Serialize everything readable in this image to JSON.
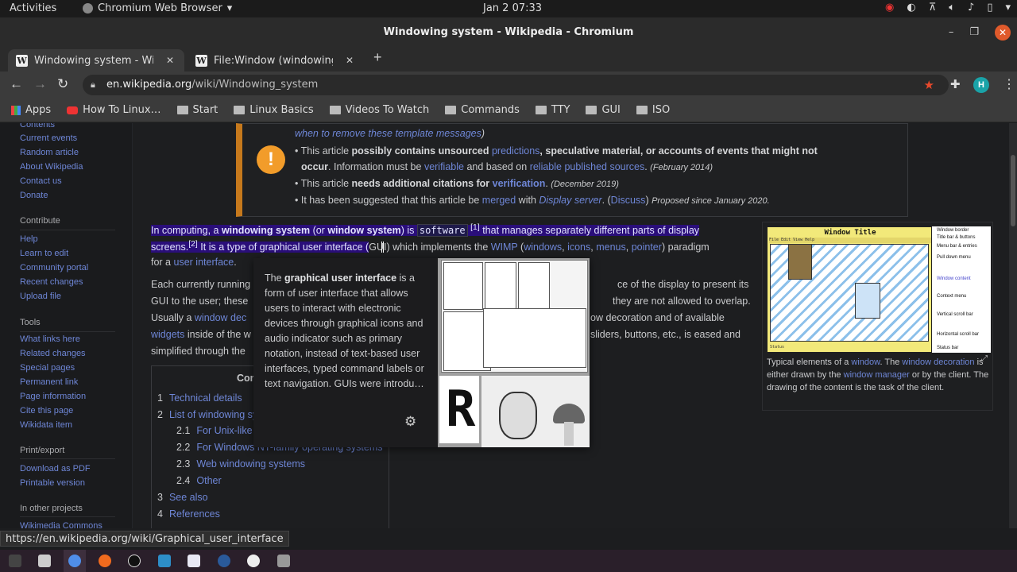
{
  "topbar": {
    "activities": "Activities",
    "app_name": "Chromium Web Browser",
    "clock": "Jan 2  07:33"
  },
  "window": {
    "title": "Windowing system - Wikipedia - Chromium",
    "minimize": "–",
    "maximize": "❐",
    "close": "✕"
  },
  "tabs": [
    {
      "label": "Windowing system - Wiki",
      "favicon": "W",
      "close": "✕"
    },
    {
      "label": "File:Window (windowing",
      "favicon": "W",
      "close": "✕"
    }
  ],
  "new_tab": "+",
  "toolbar": {
    "back": "←",
    "forward": "→",
    "reload": "↻",
    "url_host": "en.wikipedia.org",
    "url_path": "/wiki/Windowing_system",
    "avatar_letter": "H"
  },
  "bookmarks": [
    {
      "label": "Apps",
      "icon": "apps-grid-icon"
    },
    {
      "label": "How To Linux…",
      "icon": "youtube-icon"
    },
    {
      "label": "Start",
      "icon": "folder-icon"
    },
    {
      "label": "Linux Basics",
      "icon": "folder-icon"
    },
    {
      "label": "Videos To Watch",
      "icon": "folder-icon"
    },
    {
      "label": "Commands",
      "icon": "folder-icon"
    },
    {
      "label": "TTY",
      "icon": "folder-icon"
    },
    {
      "label": "GUI",
      "icon": "folder-icon"
    },
    {
      "label": "ISO",
      "icon": "folder-icon"
    }
  ],
  "sidebar": {
    "nav": [
      "Contents",
      "Current events",
      "Random article",
      "About Wikipedia",
      "Contact us",
      "Donate"
    ],
    "contribute_heading": "Contribute",
    "contribute": [
      "Help",
      "Learn to edit",
      "Community portal",
      "Recent changes",
      "Upload file"
    ],
    "tools_heading": "Tools",
    "tools": [
      "What links here",
      "Related changes",
      "Special pages",
      "Permanent link",
      "Page information",
      "Cite this page",
      "Wikidata item"
    ],
    "print_heading": "Print/export",
    "print": [
      "Download as PDF",
      "Printable version"
    ],
    "other_heading": "In other projects",
    "other": [
      "Wikimedia Commons"
    ]
  },
  "ambox": {
    "top_line": "when to remove these template messages",
    "item1_pre": "This article ",
    "item1_bold": "possibly contains unsourced ",
    "item1_link": "predictions",
    "item1_bold2": ", speculative material, or accounts of events that might not",
    "item1_line2_bold": "occur",
    "item1_line2_text": ". Information must be ",
    "item1_link2": "verifiable",
    "item1_text3": " and based on ",
    "item1_link3": "reliable published sources",
    "item1_date": "(February 2014)",
    "item2_pre": "This article ",
    "item2_bold": "needs additional citations for ",
    "item2_link": "verification",
    "item2_date": "(December 2019)",
    "item3_pre": "It has been suggested that this article be ",
    "item3_link": "merged",
    "item3_mid": " with ",
    "item3_link2": "Display server",
    "item3_discuss": "Discuss",
    "item3_date": "Proposed since January 2020."
  },
  "intro": {
    "l1_a": "In computing, a ",
    "l1_b": "windowing system",
    "l1_c": " (or ",
    "l1_d": "window system",
    "l1_e": ") is ",
    "l1_code": "software",
    "l1_ref": "[1]",
    "l1_f": " that manages separately different parts of display",
    "l2_a": "screens.",
    "l2_ref": "[2]",
    "l2_b": " It is a type of graphical user interface (",
    "l2_c": "GUI) which implements the ",
    "l2_wimp": "WIMP",
    "l2_windows": "windows",
    "l2_icons": "icons",
    "l2_menus": "menus",
    "l2_pointer": "pointer",
    "l2_end": ") paradigm",
    "l3_a": "for a ",
    "l3_link": "user interface",
    "p2_l1a": "Each currently running",
    "p2_l1b": "ce of the display to present its",
    "p2_l2a": "GUI to the user; these",
    "p2_l2b": "they are not allowed to overlap.",
    "p2_l3a": "Usually a ",
    "p2_l3link": "window dec",
    "p2_l3b": "ow decoration and of available",
    "p2_l4link": "widgets",
    "p2_l4a": " inside of the w",
    "p2_l4b": "sliders, buttons, etc., is eased and",
    "p2_l5a": "simplified through the"
  },
  "toc": {
    "title": "Contents",
    "items": [
      {
        "num": "1",
        "label": "Technical details"
      },
      {
        "num": "2",
        "label": "List of windowing systems"
      },
      {
        "num": "2.1",
        "label": "For Unix-like"
      },
      {
        "num": "2.2",
        "label": "For Windows NT-family operating systems"
      },
      {
        "num": "2.3",
        "label": "Web windowing systems"
      },
      {
        "num": "2.4",
        "label": "Other"
      },
      {
        "num": "3",
        "label": "See also"
      },
      {
        "num": "4",
        "label": "References"
      }
    ]
  },
  "popup": {
    "pre": "The ",
    "bold": "graphical user interface",
    "text": " is a form of user interface that allows users to interact with electronic devices through graphical icons and audio indicator such as primary notation, instead of text-based user interfaces, typed command labels or text navigation. GUIs were introdu…"
  },
  "figure": {
    "window_title": "Window Title",
    "menu": "File Edit View Help",
    "status": "Status",
    "labels": [
      "Window border",
      "Title bar & buttons",
      "Menu bar & entries",
      "Pull down menu",
      "Window content",
      "Context menu",
      "Vertical scroll bar",
      "Horizontal scroll bar",
      "Status bar"
    ],
    "cap_a": "Typical elements of a ",
    "cap_link1": "window",
    "cap_b": ". The ",
    "cap_link2": "window decoration",
    "cap_c": " is either drawn by the ",
    "cap_link3": "window manager",
    "cap_d": " or by the client. The drawing of the content is the task of the client."
  },
  "status_url": "https://en.wikipedia.org/wiki/Graphical_user_interface",
  "dock": [
    "terminal",
    "files",
    "chromium",
    "firefox",
    "obs",
    "text-editor",
    "notes",
    "steam",
    "vscode",
    "trash"
  ]
}
